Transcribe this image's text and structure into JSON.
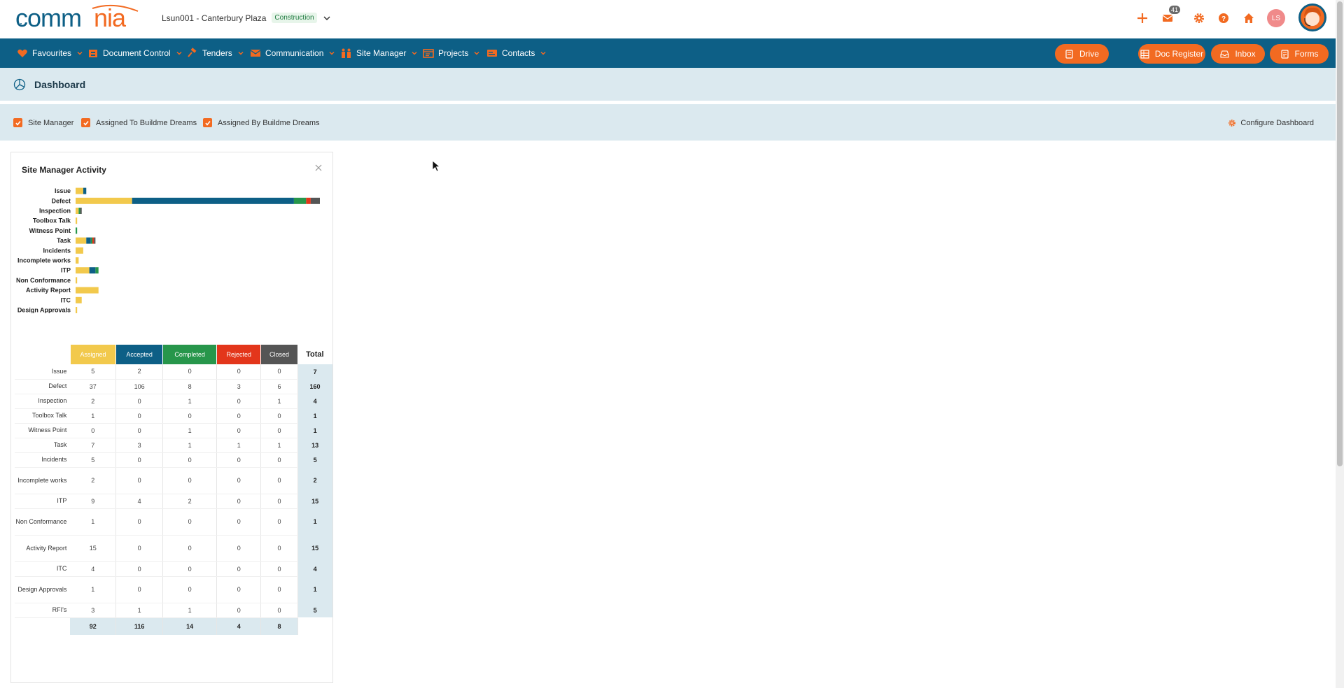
{
  "brand": {
    "name": "commnia",
    "accent": "#f26a21",
    "navy": "#0d5f86"
  },
  "project": {
    "name": "Lsun001 - Canterbury Plaza",
    "badge": "Construction"
  },
  "header_icons": [
    "plus-icon",
    "mail-icon",
    "gear-icon",
    "help-icon",
    "home-icon"
  ],
  "mail_count": "41",
  "user_initials": "LS",
  "nav": {
    "items": [
      {
        "label": "Favourites",
        "icon": "heart-icon"
      },
      {
        "label": "Document Control",
        "icon": "cabinet-icon"
      },
      {
        "label": "Tenders",
        "icon": "gavel-icon"
      },
      {
        "label": "Communication",
        "icon": "envelope-icon"
      },
      {
        "label": "Site Manager",
        "icon": "workers-icon"
      },
      {
        "label": "Projects",
        "icon": "folder-icon"
      },
      {
        "label": "Contacts",
        "icon": "contact-card-icon"
      }
    ],
    "buttons": [
      {
        "label": "Drive",
        "icon": "drive-icon"
      },
      {
        "label": "Doc Register",
        "icon": "register-icon"
      },
      {
        "label": "Inbox",
        "icon": "inbox-icon"
      },
      {
        "label": "Forms",
        "icon": "forms-icon"
      }
    ]
  },
  "page": {
    "title": "Dashboard"
  },
  "filters": {
    "items": [
      {
        "label": "Site Manager",
        "checked": true
      },
      {
        "label": "Assigned To Buildme Dreams",
        "checked": true
      },
      {
        "label": "Assigned By Buildme Dreams",
        "checked": true
      }
    ],
    "configure_label": "Configure Dashboard"
  },
  "widget": {
    "title": "Site Manager Activity",
    "columns": [
      "Assigned",
      "Accepted",
      "Completed",
      "Rejected",
      "Closed"
    ],
    "total_label": "Total",
    "column_colors": [
      "#f2c94c",
      "#0d5f86",
      "#27964b",
      "#e3361b",
      "#555555"
    ],
    "rows": [
      {
        "label": "Issue",
        "values": [
          "5",
          "2",
          "0",
          "0",
          "0"
        ],
        "total": "7"
      },
      {
        "label": "Defect",
        "values": [
          "37",
          "106",
          "8",
          "3",
          "6"
        ],
        "total": "160"
      },
      {
        "label": "Inspection",
        "values": [
          "2",
          "0",
          "1",
          "0",
          "1"
        ],
        "total": "4"
      },
      {
        "label": "Toolbox Talk",
        "values": [
          "1",
          "0",
          "0",
          "0",
          "0"
        ],
        "total": "1"
      },
      {
        "label": "Witness Point",
        "values": [
          "0",
          "0",
          "1",
          "0",
          "0"
        ],
        "total": "1"
      },
      {
        "label": "Task",
        "values": [
          "7",
          "3",
          "1",
          "1",
          "1"
        ],
        "total": "13"
      },
      {
        "label": "Incidents",
        "values": [
          "5",
          "0",
          "0",
          "0",
          "0"
        ],
        "total": "5"
      },
      {
        "label": "Incomplete works",
        "values": [
          "2",
          "0",
          "0",
          "0",
          "0"
        ],
        "total": "2"
      },
      {
        "label": "ITP",
        "values": [
          "9",
          "4",
          "2",
          "0",
          "0"
        ],
        "total": "15"
      },
      {
        "label": "Non Conformance",
        "values": [
          "1",
          "0",
          "0",
          "0",
          "0"
        ],
        "total": "1"
      },
      {
        "label": "Activity Report",
        "values": [
          "15",
          "0",
          "0",
          "0",
          "0"
        ],
        "total": "15"
      },
      {
        "label": "ITC",
        "values": [
          "4",
          "0",
          "0",
          "0",
          "0"
        ],
        "total": "4"
      },
      {
        "label": "Design Approvals",
        "values": [
          "1",
          "0",
          "0",
          "0",
          "0"
        ],
        "total": "1"
      },
      {
        "label": "RFI's",
        "values": [
          "3",
          "1",
          "1",
          "0",
          "0"
        ],
        "total": "5"
      }
    ],
    "footer_totals": [
      "92",
      "116",
      "14",
      "4",
      "8"
    ]
  },
  "chart_data": {
    "type": "bar",
    "orientation": "horizontal",
    "stacked": true,
    "categories": [
      "Issue",
      "Defect",
      "Inspection",
      "Toolbox Talk",
      "Witness Point",
      "Task",
      "Incidents",
      "Incomplete works",
      "ITP",
      "Non Conformance",
      "Activity Report",
      "ITC",
      "Design Approvals",
      "RFI's"
    ],
    "series": [
      {
        "name": "Assigned",
        "values": [
          5,
          37,
          2,
          1,
          0,
          7,
          5,
          2,
          9,
          1,
          15,
          4,
          1,
          3
        ]
      },
      {
        "name": "Accepted",
        "values": [
          2,
          106,
          0,
          0,
          0,
          3,
          0,
          0,
          4,
          0,
          0,
          0,
          0,
          1
        ]
      },
      {
        "name": "Completed",
        "values": [
          0,
          8,
          1,
          0,
          1,
          1,
          0,
          0,
          2,
          0,
          0,
          0,
          0,
          1
        ]
      },
      {
        "name": "Rejected",
        "values": [
          0,
          3,
          0,
          0,
          0,
          1,
          0,
          0,
          0,
          0,
          0,
          0,
          0,
          0
        ]
      },
      {
        "name": "Closed",
        "values": [
          0,
          6,
          1,
          0,
          0,
          1,
          0,
          0,
          0,
          0,
          0,
          0,
          0,
          0
        ]
      }
    ],
    "xticks": [
      "0",
      "20",
      "40",
      "60",
      "80",
      "100",
      "120",
      "140",
      "160"
    ],
    "xlim": [
      0,
      160
    ],
    "grid": false
  }
}
